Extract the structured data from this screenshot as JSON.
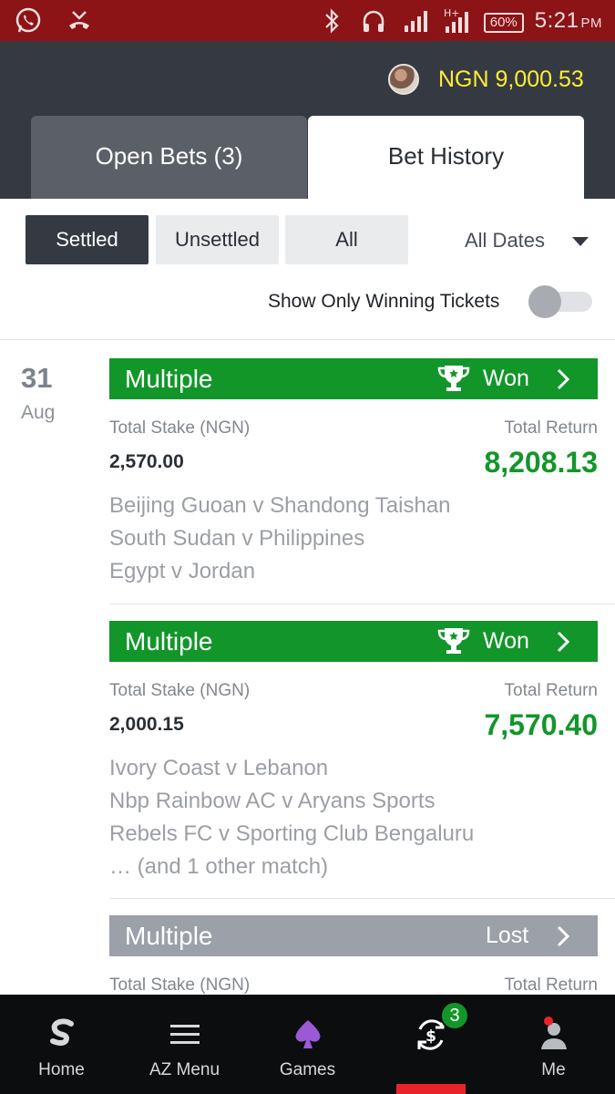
{
  "statusbar": {
    "battery": "60%",
    "time": "5:21",
    "ampm": "PM",
    "network": "H+"
  },
  "header": {
    "balance": "NGN 9,000.53",
    "tabs": [
      {
        "label": "Open Bets (3)"
      },
      {
        "label": "Bet History"
      }
    ]
  },
  "filters": {
    "settled": "Settled",
    "unsettled": "Unsettled",
    "all": "All",
    "dates": "All Dates",
    "winning_toggle": "Show Only Winning Tickets"
  },
  "date_group": {
    "day": "31",
    "month": "Aug"
  },
  "bets": [
    {
      "type": "Multiple",
      "status": "Won",
      "stake_label": "Total Stake (NGN)",
      "return_label": "Total Return",
      "stake": "2,570.00",
      "return": "8,208.13",
      "matches": [
        "Beijing Guoan v Shandong Taishan",
        "South Sudan v Philippines",
        "Egypt v Jordan"
      ]
    },
    {
      "type": "Multiple",
      "status": "Won",
      "stake_label": "Total Stake (NGN)",
      "return_label": "Total Return",
      "stake": "2,000.15",
      "return": "7,570.40",
      "matches": [
        "Ivory Coast v Lebanon",
        "Nbp Rainbow AC v Aryans Sports",
        "Rebels FC v Sporting Club Bengaluru",
        "… (and 1 other match)"
      ]
    },
    {
      "type": "Multiple",
      "status": "Lost",
      "stake_label": "Total Stake (NGN)",
      "return_label": "Total Return"
    }
  ],
  "nav": {
    "items": [
      {
        "label": "Home"
      },
      {
        "label": "AZ Menu"
      },
      {
        "label": "Games"
      },
      {
        "label": ""
      },
      {
        "label": "Me"
      }
    ],
    "badge": "3"
  },
  "colors": {
    "statusbar": "#8c1316",
    "header": "#353a42",
    "won": "#12962a",
    "lost": "#9ca0a8",
    "balance": "#ffee34",
    "active": "#e8242a"
  }
}
